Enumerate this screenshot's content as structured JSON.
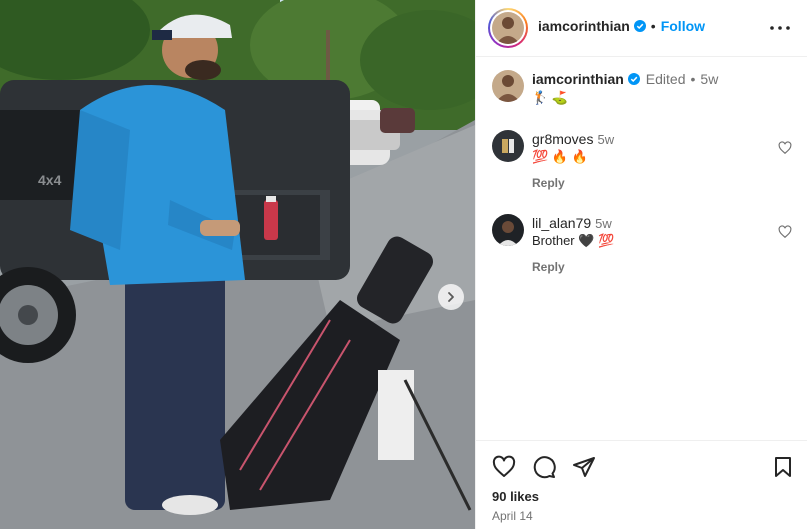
{
  "post": {
    "username": "iamcorinthian",
    "follow_label": "Follow",
    "dot_separator": "•",
    "more_icon": "more-horizontal-icon",
    "next_icon": "chevron-right-icon"
  },
  "caption": {
    "username": "iamcorinthian",
    "edited_label": "Edited",
    "dot_separator": "•",
    "time": "5w",
    "text": "🏌️ ⛳"
  },
  "comments": [
    {
      "username": "gr8moves",
      "time": "5w",
      "text": "💯 🔥 🔥",
      "reply_label": "Reply"
    },
    {
      "username": "lil_alan79",
      "time": "5w",
      "text": "Brother 🖤 💯",
      "reply_label": "Reply"
    }
  ],
  "footer": {
    "likes": "90 likes",
    "date": "April 14"
  },
  "colors": {
    "accent": "#0095f6",
    "text": "#262626",
    "muted": "#737373",
    "jacket": "#2b94d8"
  }
}
